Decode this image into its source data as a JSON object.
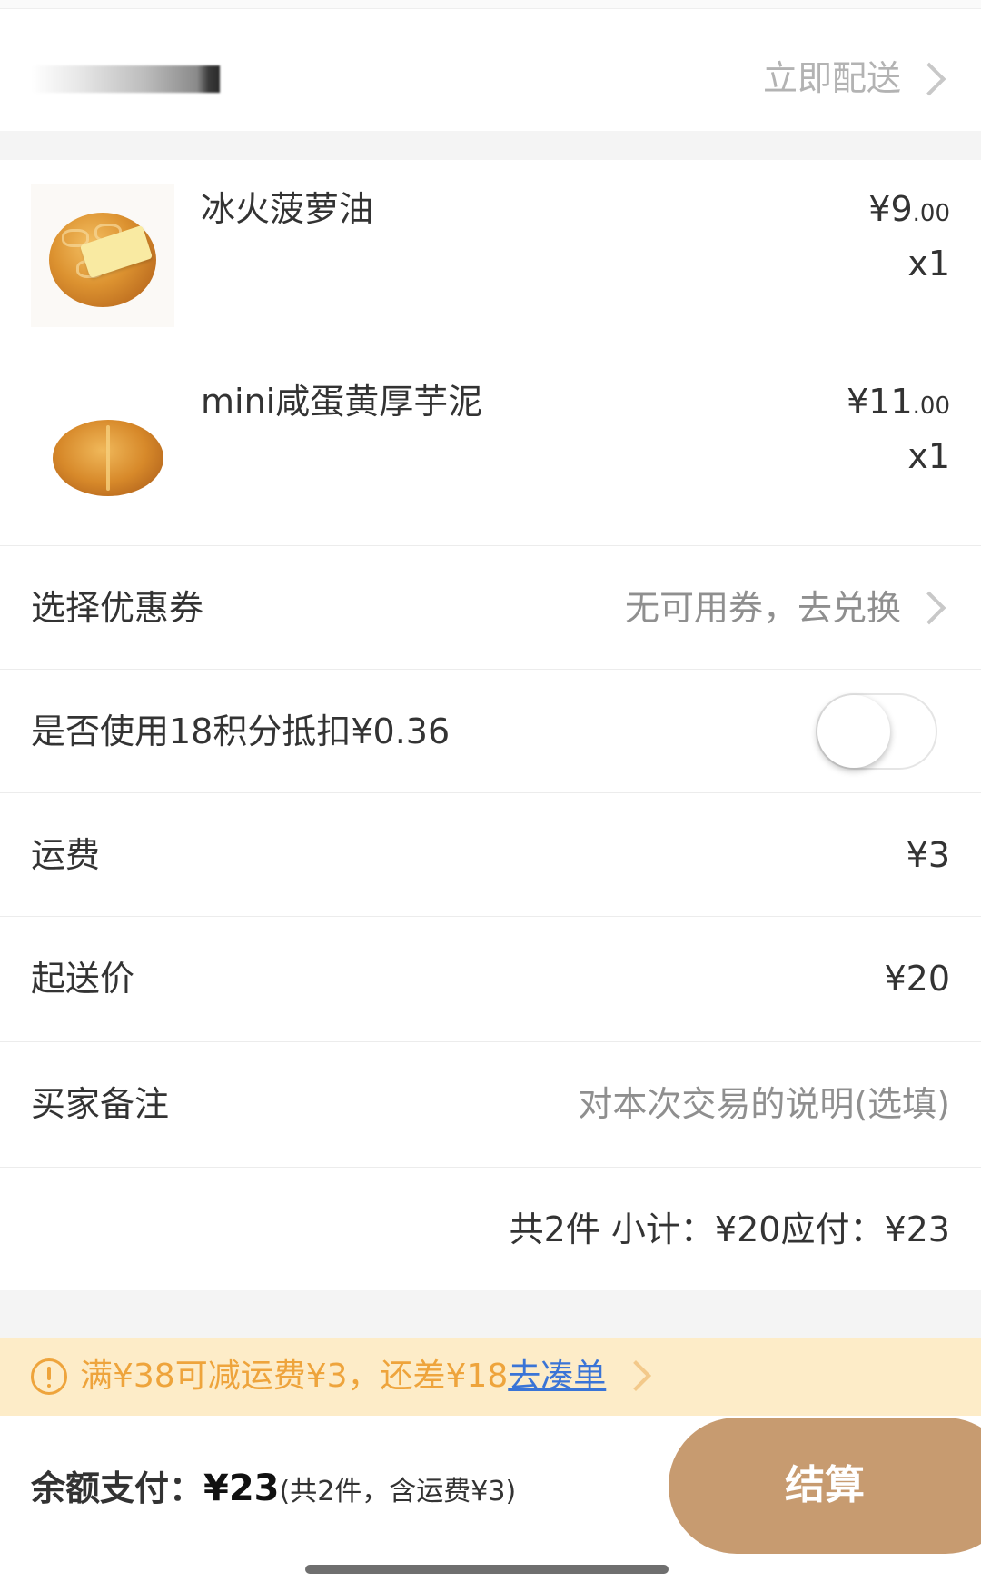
{
  "delivery": {
    "mode": "立即配送"
  },
  "products": [
    {
      "name": "冰火菠萝油",
      "price_int": "¥9",
      "price_dec": ".00",
      "qty": "x1"
    },
    {
      "name": "mini咸蛋黄厚芋泥",
      "price_int": "¥11",
      "price_dec": ".00",
      "qty": "x1"
    }
  ],
  "coupon": {
    "label": "选择优惠券",
    "value": "无可用券，去兑换"
  },
  "points": {
    "label": "是否使用18积分抵扣¥0.36",
    "enabled": false
  },
  "shipping": {
    "label": "运费",
    "value": "¥3"
  },
  "minimum": {
    "label": "起送价",
    "value": "¥20"
  },
  "remark": {
    "label": "买家备注",
    "placeholder": "对本次交易的说明(选填)"
  },
  "summary": {
    "text": "共2件 小计：¥20应付：¥23"
  },
  "promo": {
    "text": "满¥38可减运费¥3，还差¥18",
    "link": "去凑单"
  },
  "payment": {
    "label": "余额支付：",
    "amount": "¥23",
    "detail": "(共2件，含运费¥3)"
  },
  "checkout": {
    "label": "结算"
  },
  "colors": {
    "accent": "#c79b70",
    "promo_bg": "#fdecc8",
    "promo_text": "#eea43c",
    "link": "#3a74d6"
  }
}
